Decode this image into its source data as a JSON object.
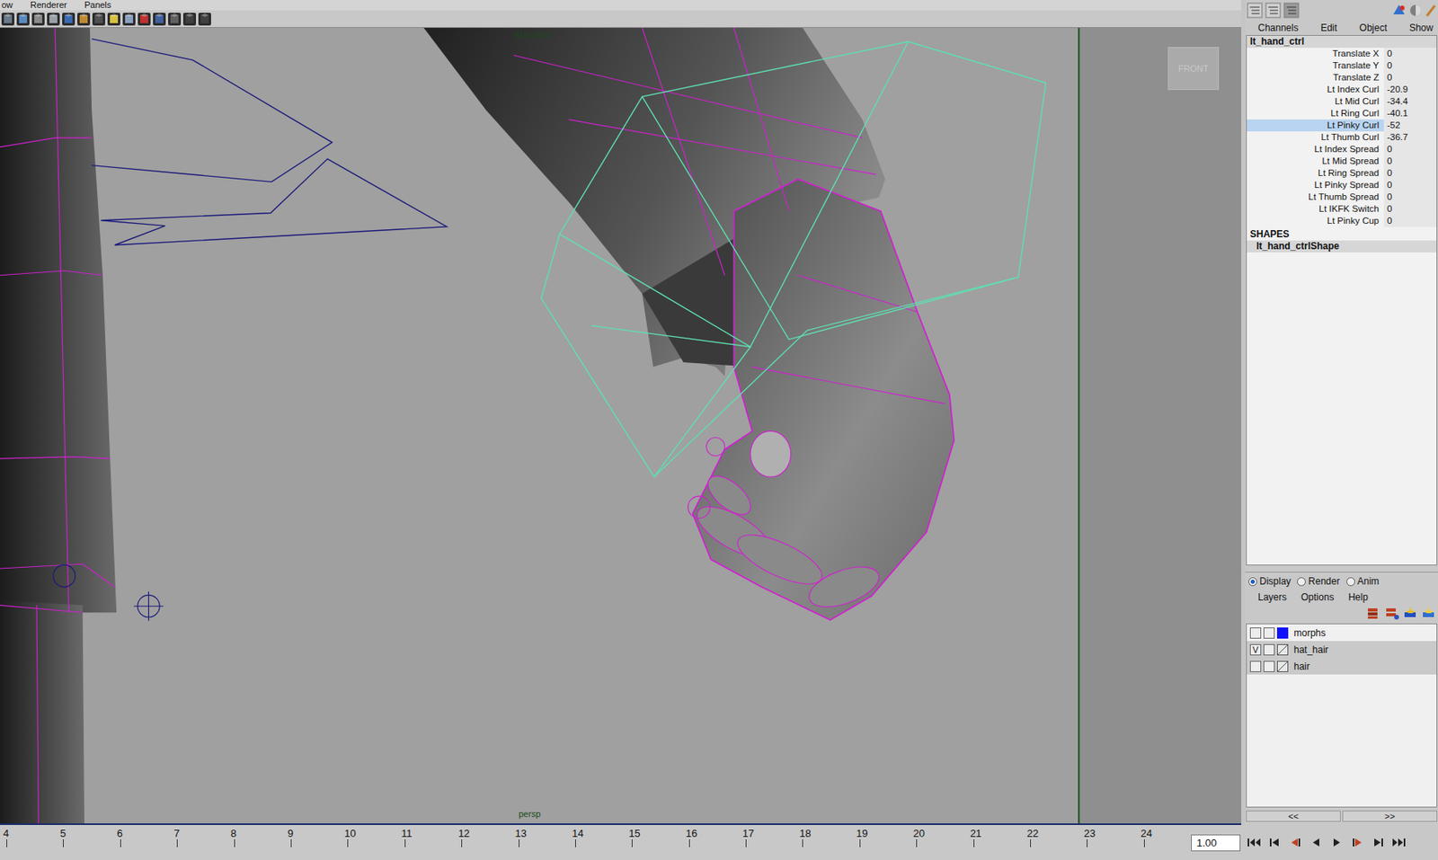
{
  "menu_bar": [
    {
      "label": "ow"
    },
    {
      "label": "Renderer"
    },
    {
      "label": "Panels"
    }
  ],
  "viewport": {
    "resolution_gate": "810 x 810",
    "camera": "persp",
    "view_cube": "FRONT"
  },
  "channel_box": {
    "menus": [
      "Channels",
      "Edit",
      "Object",
      "Show"
    ],
    "object": "lt_hand_ctrl",
    "attributes": [
      {
        "name": "Translate X",
        "value": "0",
        "selected": false
      },
      {
        "name": "Translate Y",
        "value": "0",
        "selected": false
      },
      {
        "name": "Translate Z",
        "value": "0",
        "selected": false
      },
      {
        "name": "Lt Index Curl",
        "value": "-20.9",
        "selected": false
      },
      {
        "name": "Lt Mid Curl",
        "value": "-34.4",
        "selected": false
      },
      {
        "name": "Lt Ring Curl",
        "value": "-40.1",
        "selected": false
      },
      {
        "name": "Lt Pinky Curl",
        "value": "-52",
        "selected": true
      },
      {
        "name": "Lt Thumb Curl",
        "value": "-36.7",
        "selected": false
      },
      {
        "name": "Lt Index Spread",
        "value": "0",
        "selected": false
      },
      {
        "name": "Lt Mid Spread",
        "value": "0",
        "selected": false
      },
      {
        "name": "Lt Ring Spread",
        "value": "0",
        "selected": false
      },
      {
        "name": "Lt Pinky Spread",
        "value": "0",
        "selected": false
      },
      {
        "name": "Lt Thumb Spread",
        "value": "0",
        "selected": false
      },
      {
        "name": "Lt IKFK Switch",
        "value": "0",
        "selected": false
      },
      {
        "name": "Lt Pinky Cup",
        "value": "0",
        "selected": false
      }
    ],
    "shapes_header": "SHAPES",
    "shapes": [
      {
        "name": "lt_hand_ctrlShape",
        "selected": true
      }
    ]
  },
  "layer_editor": {
    "modes": [
      {
        "label": "Display",
        "selected": true
      },
      {
        "label": "Render",
        "selected": false
      },
      {
        "label": "Anim",
        "selected": false
      }
    ],
    "menus": [
      "Layers",
      "Options",
      "Help"
    ],
    "visible_mark": "V",
    "layers": [
      {
        "name": "morphs",
        "visible": false,
        "selected": false,
        "color": "#1010ff"
      },
      {
        "name": "hat_hair",
        "visible": true,
        "selected": true,
        "color": ""
      },
      {
        "name": "hair",
        "visible": false,
        "selected": true,
        "color": ""
      }
    ],
    "scroll": [
      "<<",
      ">>"
    ]
  },
  "timeline": {
    "ticks": [
      "4",
      "5",
      "6",
      "7",
      "8",
      "9",
      "10",
      "11",
      "12",
      "13",
      "14",
      "15",
      "16",
      "17",
      "18",
      "19",
      "20",
      "21",
      "22",
      "23",
      "24"
    ],
    "current_frame": "1.00"
  }
}
